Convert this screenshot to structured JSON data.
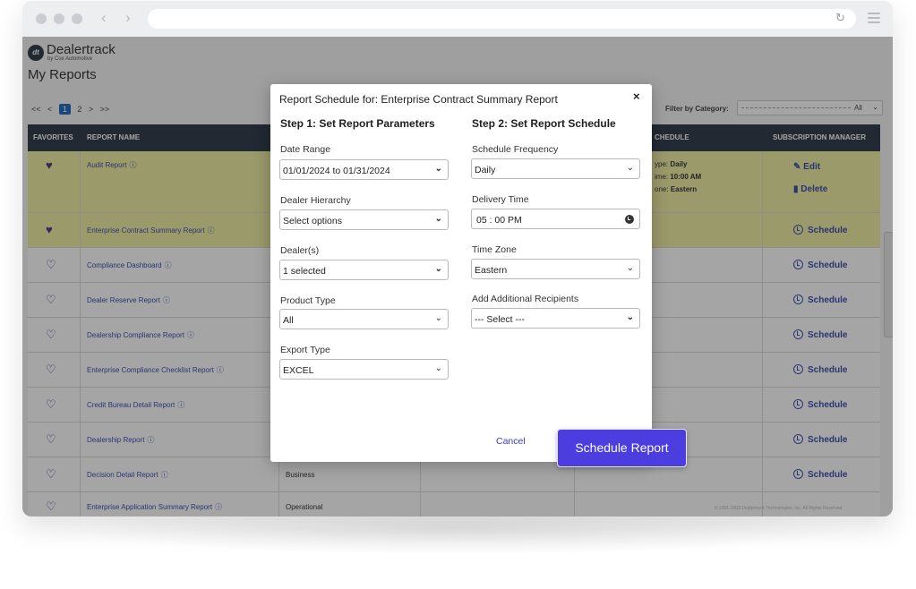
{
  "app": {
    "brand_name": "Dealertrack",
    "brand_sub": "by Cox Automotive",
    "brand_mark": "dt",
    "page_title": "My Reports"
  },
  "pager": {
    "first": "<<",
    "prev": "<",
    "pages": [
      "1",
      "2"
    ],
    "next": ">",
    "last": ">>"
  },
  "filter": {
    "label": "Filter by Category:",
    "value": "All"
  },
  "table": {
    "headers": {
      "favorites": "FAVORITES",
      "report_name": "REPORT NAME",
      "schedule": "CHEDULE",
      "subscription": "SUBSCRIPTION MANAGER"
    },
    "rows": [
      {
        "name": "Audit Report",
        "favorite": true,
        "highlight": true
      },
      {
        "name": "Enterprise Contract Summary Report",
        "favorite": true,
        "highlight": true
      },
      {
        "name": "Compliance Dashboard",
        "favorite": false,
        "highlight": false
      },
      {
        "name": "Dealer Reserve Report",
        "favorite": false,
        "highlight": false
      },
      {
        "name": "Dealership Compliance Report",
        "favorite": false,
        "highlight": false
      },
      {
        "name": "Enterprise Compliance Checklist Report",
        "favorite": false,
        "highlight": false
      },
      {
        "name": "Credit Bureau Detail Report",
        "favorite": false,
        "highlight": false
      },
      {
        "name": "Dealership Report",
        "favorite": false,
        "highlight": false
      },
      {
        "name": "Decision Detail Report",
        "favorite": false,
        "highlight": false,
        "category": "Business"
      },
      {
        "name": "Enterprise Application Summary Report",
        "favorite": false,
        "highlight": false,
        "category": "Operational"
      }
    ],
    "audit_schedule": {
      "type_label": "ype:",
      "type_value": "Daily",
      "time_label": "ime:",
      "time_value": "10:00 AM",
      "zone_label": "one:",
      "zone_value": "Eastern"
    },
    "edit_label": "Edit",
    "delete_label": "Delete",
    "schedule_label": "Schedule",
    "info_icon": "ⓘ"
  },
  "footer": {
    "copyright": "© 2001-2009 Dealertrack Technologies, Inc. All Rights Reserved"
  },
  "modal": {
    "title": "Report Schedule for: Enterprise Contract Summary Report",
    "close": "×",
    "step1": "Step 1: Set Report Parameters",
    "step2": "Step 2: Set Report Schedule",
    "fields": {
      "date_range": {
        "label": "Date Range",
        "value": "01/01/2024 to 01/31/2024"
      },
      "dealer_hierarchy": {
        "label": "Dealer Hierarchy",
        "value": "Select options"
      },
      "dealers": {
        "label": "Dealer(s)",
        "value": "1 selected"
      },
      "product_type": {
        "label": "Product Type",
        "value": "All"
      },
      "export_type": {
        "label": "Export Type",
        "value": "EXCEL"
      },
      "schedule_frequency": {
        "label": "Schedule Frequency",
        "value": "Daily"
      },
      "delivery_time": {
        "label": "Delivery Time",
        "value": "05 : 00  PM"
      },
      "time_zone": {
        "label": "Time Zone",
        "value": "Eastern"
      },
      "recipients": {
        "label": "Add Additional Recipients",
        "value": "--- Select ---"
      }
    },
    "cancel": "Cancel",
    "submit": "Schedule Report"
  },
  "colors": {
    "accent": "#4b3de0",
    "header_bg": "#1e2a3a",
    "highlight_row": "#eded9c",
    "link": "#2a3ea6"
  }
}
